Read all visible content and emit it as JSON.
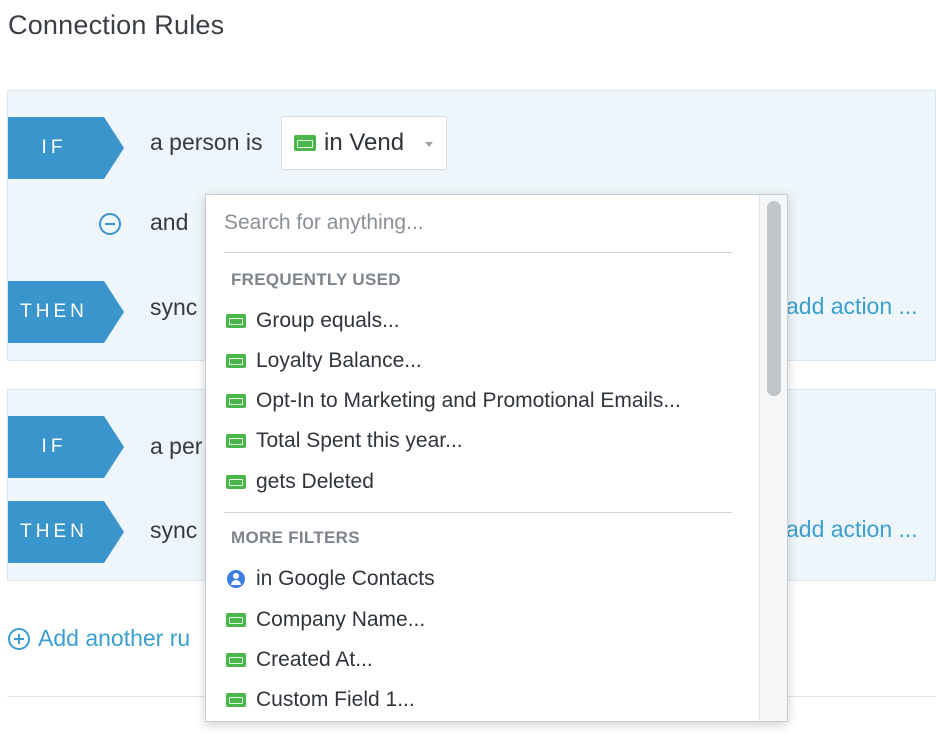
{
  "page": {
    "title": "Connection Rules"
  },
  "rule1": {
    "if_tag": "IF",
    "if_text": "a person is",
    "app_select": {
      "label": "in Vend",
      "icon": "vend-icon"
    },
    "and_text": "and",
    "then_tag": "THEN",
    "then_text": "sync",
    "add_action": "add action ..."
  },
  "rule2": {
    "if_tag": "IF",
    "if_text": "a per",
    "then_tag": "THEN",
    "then_text": "sync",
    "add_action": "add action ..."
  },
  "add_rule": "Add another ru",
  "dropdown": {
    "search_placeholder": "Search for anything...",
    "frequently_used_header": "FREQUENTLY USED",
    "frequently_used": [
      {
        "label": "Group equals...",
        "icon": "vend-icon"
      },
      {
        "label": "Loyalty Balance...",
        "icon": "vend-icon"
      },
      {
        "label": "Opt-In to Marketing and Promotional Emails...",
        "icon": "vend-icon"
      },
      {
        "label": "Total Spent this year...",
        "icon": "vend-icon"
      },
      {
        "label": "gets Deleted",
        "icon": "vend-icon"
      }
    ],
    "more_filters_header": "MORE FILTERS",
    "more_filters": [
      {
        "label": "in Google Contacts",
        "icon": "google-contacts-icon"
      },
      {
        "label": "Company Name...",
        "icon": "vend-icon"
      },
      {
        "label": "Created At...",
        "icon": "vend-icon"
      },
      {
        "label": "Custom Field 1...",
        "icon": "vend-icon"
      }
    ]
  },
  "colors": {
    "accent": "#3a95cc",
    "link": "#3a9fd0",
    "vend_green": "#49b749",
    "card_bg": "#eef6fb"
  }
}
